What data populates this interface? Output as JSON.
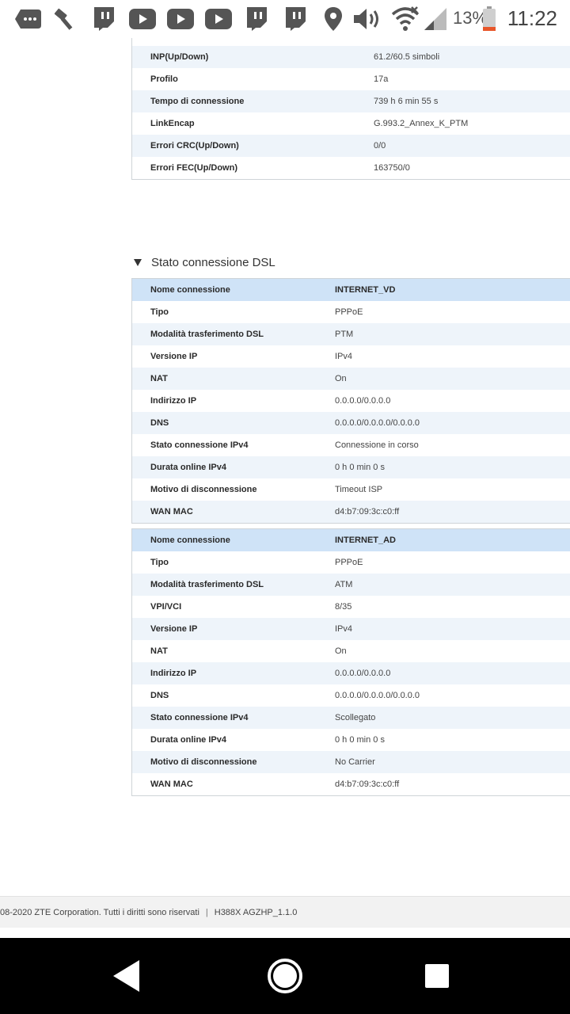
{
  "status_bar": {
    "battery_percent": "13%",
    "time": "11:22",
    "icons": [
      "chat-bubble-icon",
      "hammer-icon",
      "twitch-icon",
      "youtube-icon",
      "youtube-icon",
      "youtube-icon",
      "twitch-icon",
      "twitch-icon",
      "location-pin-icon",
      "volume-icon",
      "wifi-icon",
      "cell-signal-icon",
      "battery-icon"
    ]
  },
  "top_table": {
    "rows": [
      {
        "label": "INP(Up/Down)",
        "value": "61.2/60.5 simboli"
      },
      {
        "label": "Profilo",
        "value": "17a"
      },
      {
        "label": "Tempo di connessione",
        "value": "739 h 6 min 55 s"
      },
      {
        "label": "LinkEncap",
        "value": "G.993.2_Annex_K_PTM"
      },
      {
        "label": "Errori CRC(Up/Down)",
        "value": "0/0"
      },
      {
        "label": "Errori FEC(Up/Down)",
        "value": "163750/0"
      }
    ]
  },
  "section": {
    "title": "Stato connessione DSL"
  },
  "connection_vd": {
    "header": {
      "label": "Nome connessione",
      "value": "INTERNET_VD"
    },
    "rows": [
      {
        "label": "Tipo",
        "value": "PPPoE"
      },
      {
        "label": "Modalità trasferimento DSL",
        "value": "PTM"
      },
      {
        "label": "Versione IP",
        "value": "IPv4"
      },
      {
        "label": "NAT",
        "value": "On"
      },
      {
        "label": "Indirizzo IP",
        "value": "0.0.0.0/0.0.0.0"
      },
      {
        "label": "DNS",
        "value": "0.0.0.0/0.0.0.0/0.0.0.0"
      },
      {
        "label": "Stato connessione IPv4",
        "value": "Connessione in corso"
      },
      {
        "label": "Durata online IPv4",
        "value": "0 h 0 min 0 s"
      },
      {
        "label": "Motivo di disconnessione",
        "value": "Timeout ISP"
      },
      {
        "label": "WAN MAC",
        "value": "d4:b7:09:3c:c0:ff"
      }
    ]
  },
  "connection_ad": {
    "header": {
      "label": "Nome connessione",
      "value": "INTERNET_AD"
    },
    "rows": [
      {
        "label": "Tipo",
        "value": "PPPoE"
      },
      {
        "label": "Modalità trasferimento DSL",
        "value": "ATM"
      },
      {
        "label": "VPI/VCI",
        "value": "8/35"
      },
      {
        "label": "Versione IP",
        "value": "IPv4"
      },
      {
        "label": "NAT",
        "value": "On"
      },
      {
        "label": "Indirizzo IP",
        "value": "0.0.0.0/0.0.0.0"
      },
      {
        "label": "DNS",
        "value": "0.0.0.0/0.0.0.0/0.0.0.0"
      },
      {
        "label": "Stato connessione IPv4",
        "value": "Scollegato"
      },
      {
        "label": "Durata online IPv4",
        "value": "0 h 0 min 0 s"
      },
      {
        "label": "Motivo di disconnessione",
        "value": "No Carrier"
      },
      {
        "label": "WAN MAC",
        "value": "d4:b7:09:3c:c0:ff"
      }
    ]
  },
  "footer": {
    "copyright": "08-2020 ZTE Corporation. Tutti i diritti sono riservati",
    "separator": "|",
    "version": "H388X AGZHP_1.1.0"
  },
  "nav_bar": {
    "icons": [
      "back-icon",
      "home-icon",
      "recents-icon"
    ]
  }
}
